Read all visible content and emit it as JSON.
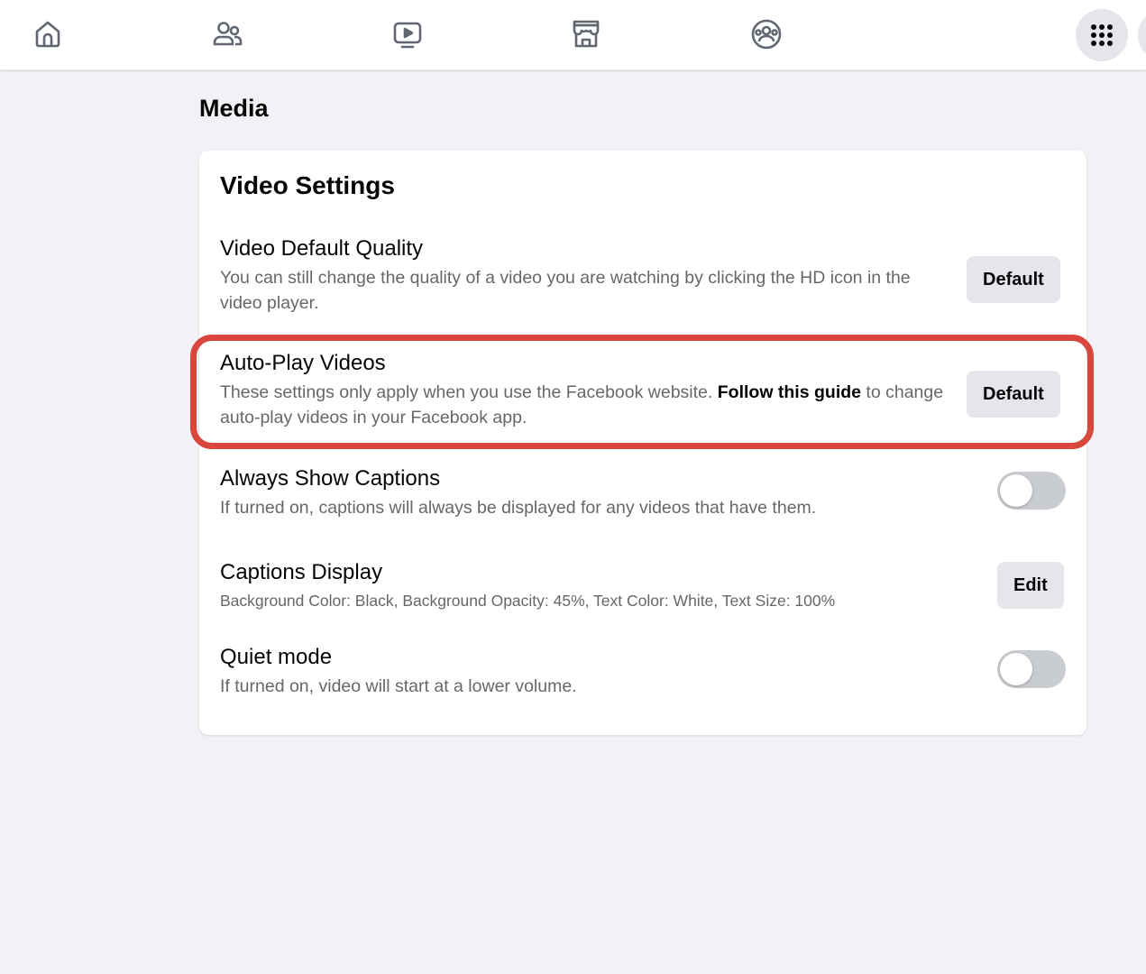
{
  "nav": {
    "icons": [
      "home-icon",
      "friends-icon",
      "watch-icon",
      "marketplace-icon",
      "groups-icon"
    ],
    "menu_icon": "grid-menu-icon"
  },
  "page": {
    "section_title": "Media"
  },
  "card": {
    "title": "Video Settings",
    "rows": [
      {
        "title": "Video Default Quality",
        "description": "You can still change the quality of a video you are watching by clicking the HD icon in the video player.",
        "control": "Default"
      },
      {
        "title": "Auto-Play Videos",
        "description": "These settings only apply when you use the Facebook website.",
        "link": "Follow this guide",
        "description_after": "to change auto-play videos in your Facebook app.",
        "control": "Default"
      },
      {
        "title": "Always Show Captions",
        "description": "If turned on, captions will always be displayed for any videos that have them.",
        "toggle_on": false
      },
      {
        "title": "Captions Display",
        "description": "Background Color: Black, Background Opacity: 45%, Text Color: White, Text Size: 100%",
        "control": "Edit"
      },
      {
        "title": "Quiet mode",
        "description": "If turned on, video will start at a lower volume.",
        "toggle_on": false
      }
    ]
  },
  "colors": {
    "highlight": "#d9463b",
    "background": "#f0f2f5",
    "button": "#e4e6eb",
    "secondary_text": "#65676b"
  }
}
